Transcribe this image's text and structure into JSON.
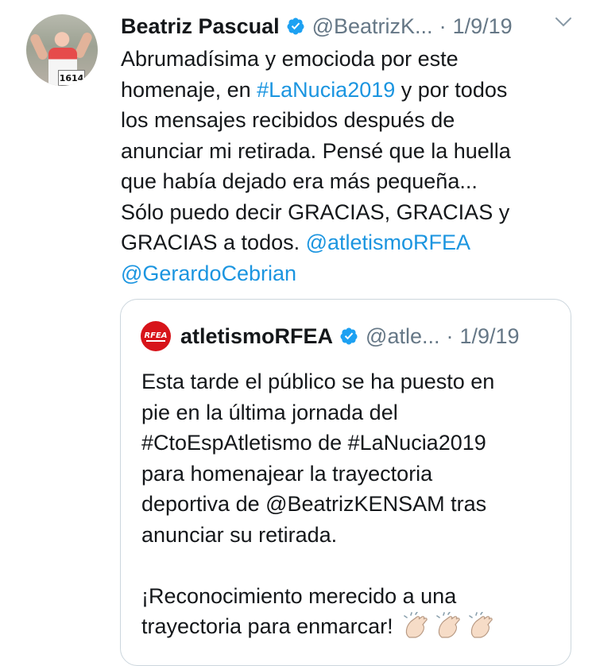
{
  "tweet": {
    "author_name": "Beatriz Pascual",
    "handle": "@BeatrizK...",
    "separator": "·",
    "date": "1/9/19",
    "avatar_bib": "1614",
    "text_before_hashtag": "Abrumadísima y emocioda por este\nhomenaje, en ",
    "hashtag": "#LaNucia2019",
    "text_after_hashtag": " y por todos\nlos mensajes recibidos después de\nanunciar mi retirada. Pensé que la huella\nque había dejado era más pequeña...\nSólo puedo decir GRACIAS, GRACIAS y\nGRACIAS a todos. ",
    "mention_1": "@atletismoRFEA",
    "mention_2": "@GerardoCebrian"
  },
  "quoted_tweet": {
    "author_name": "atletismoRFEA",
    "handle": "@atle...",
    "separator": "·",
    "date": "1/9/19",
    "logo_text": "RFEA",
    "text": "Esta tarde el público se ha puesto en\npie en la última jornada del\n#CtoEspAtletismo de #LaNucia2019\npara homenajear la trayectoria\ndeportiva de @BeatrizKENSAM tras\nanunciar su retirada.\n\n¡Reconocimiento merecido a una\ntrayectoria para enmarcar! ",
    "emoji": [
      "clapping-hands",
      "clapping-hands",
      "clapping-hands"
    ]
  },
  "colors": {
    "text": "#14171a",
    "secondary": "#657786",
    "link": "#1b95e0",
    "verified": "#1da1f2",
    "border": "#ccd6dd",
    "rfea_red": "#d7141a"
  }
}
